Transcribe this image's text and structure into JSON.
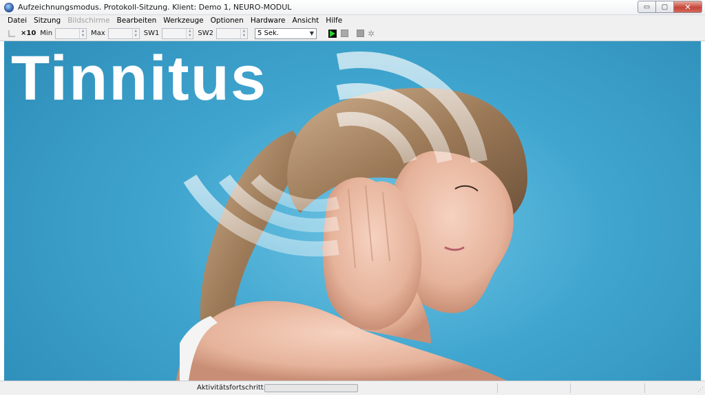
{
  "window": {
    "title": "Aufzeichnungsmodus. Protokoll-Sitzung. Klient: Demo 1, NEURO-MODUL",
    "controls": {
      "minimize": "▭",
      "maximize": "▢",
      "close": "✕"
    }
  },
  "menu": [
    {
      "label": "Datei",
      "enabled": true
    },
    {
      "label": "Sitzung",
      "enabled": true
    },
    {
      "label": "Bildschirme",
      "enabled": false
    },
    {
      "label": "Bearbeiten",
      "enabled": true
    },
    {
      "label": "Werkzeuge",
      "enabled": true
    },
    {
      "label": "Optionen",
      "enabled": true
    },
    {
      "label": "Hardware",
      "enabled": true
    },
    {
      "label": "Ansicht",
      "enabled": true
    },
    {
      "label": "Hilfe",
      "enabled": true
    }
  ],
  "toolbar": {
    "x10_label": "×10",
    "min_label": "Min",
    "min_value": "",
    "max_label": "Max",
    "max_value": "",
    "sw1_label": "SW1",
    "sw1_value": "",
    "sw2_label": "SW2",
    "sw2_value": "",
    "interval_selected": "5 Sek.",
    "play_color": "#2ccf2c"
  },
  "main": {
    "banner_title": "Tinnitus",
    "background_color": "#40a6cf"
  },
  "status": {
    "progress_label": "Aktivitätsfortschritt:",
    "progress_fraction": 0.0
  }
}
